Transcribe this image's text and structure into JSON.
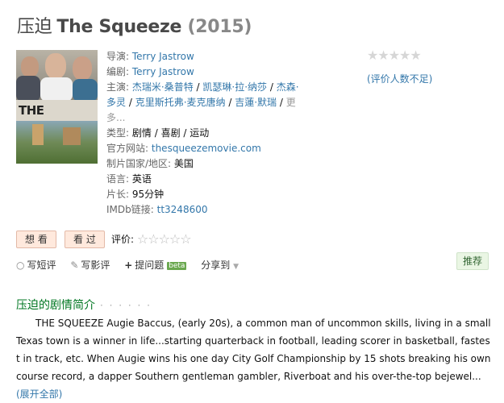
{
  "title": {
    "cn": "压迫",
    "en": "The Squeeze",
    "year": "(2015)"
  },
  "info": {
    "director_label": "导演",
    "director": "Terry Jastrow",
    "writer_label": "编剧",
    "writer": "Terry Jastrow",
    "cast_label": "主演",
    "cast": [
      "杰瑞米·桑普特",
      "凯瑟琳·拉·纳莎",
      "杰森·多灵",
      "克里斯托弗·麦克唐纳",
      "吉蓮·默瑞"
    ],
    "cast_more": "更多...",
    "genre_label": "类型",
    "genres": [
      "剧情",
      "喜剧",
      "运动"
    ],
    "site_label": "官方网站",
    "site": "thesqueezemovie.com",
    "country_label": "制片国家/地区",
    "country": "美国",
    "language_label": "语言",
    "language": "英语",
    "runtime_label": "片长",
    "runtime": "95分钟",
    "imdb_label": "IMDb链接",
    "imdb": "tt3248600"
  },
  "rating": {
    "stars": "★★★★★",
    "note": "(评价人数不足)"
  },
  "buttons": {
    "want": "想 看",
    "watched": "看 过",
    "rate_label": "评价:",
    "rate_stars": "☆☆☆☆☆"
  },
  "actions": {
    "short_review": "写短评",
    "review": "写影评",
    "ask": "提问题",
    "beta": "beta",
    "share": "分享到"
  },
  "recommend": "推荐",
  "intro": {
    "heading": "压迫的剧情简介",
    "dots": "· · · · · ·",
    "text": "THE SQUEEZE Augie Baccus, (early 20s), a common man of uncommon skills, living in a small Texas town is a winner in life...starting quarterback in football, leading scorer in basketball, fastest in track, etc. When Augie wins his one day City Golf Championship by 15 shots breaking his own course record, a dapper Southern gentleman gambler, Riverboat and his over-the-top bejewel...",
    "expand": "(展开全部)"
  },
  "icons": {
    "short_review": "speech-bubble-icon",
    "review": "pencil-icon",
    "ask": "plus-icon",
    "share": "chevron-down-icon"
  }
}
